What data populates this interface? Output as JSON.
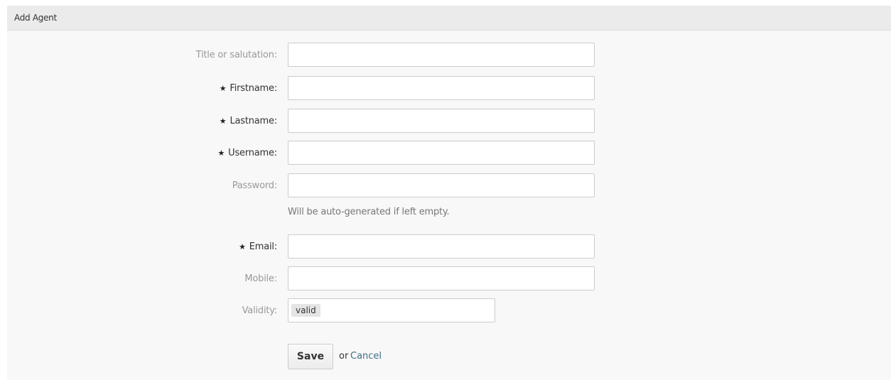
{
  "panel": {
    "title": "Add Agent"
  },
  "fields": {
    "title": {
      "label": "Title or salutation:",
      "value": ""
    },
    "firstname": {
      "label": "Firstname:",
      "star": "★",
      "value": ""
    },
    "lastname": {
      "label": "Lastname:",
      "star": "★",
      "value": ""
    },
    "username": {
      "label": "Username:",
      "star": "★",
      "value": ""
    },
    "password": {
      "label": "Password:",
      "value": "",
      "hint": "Will be auto-generated if left empty."
    },
    "email": {
      "label": "Email:",
      "star": "★",
      "value": ""
    },
    "mobile": {
      "label": "Mobile:",
      "value": ""
    },
    "validity": {
      "label": "Validity:",
      "selected": "valid"
    }
  },
  "actions": {
    "save_label": "Save",
    "or_text": "or",
    "cancel_label": "Cancel"
  },
  "colors": {
    "panel_bg": "#f8f8f8",
    "header_bg": "#ebebeb",
    "link": "#3a6f86",
    "muted_label": "#999999"
  }
}
